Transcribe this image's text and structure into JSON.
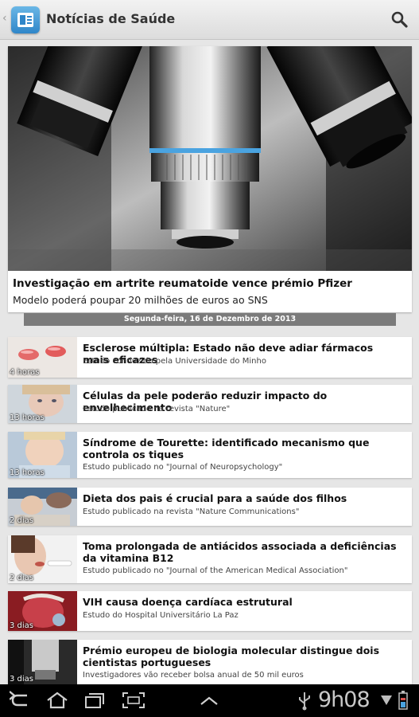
{
  "app": {
    "title": "Notícias de Saúde"
  },
  "icons": {
    "back": "back-caret-icon",
    "app": "news-app-icon",
    "search": "search-icon"
  },
  "featured": {
    "title": "Investigação em artrite reumatoide vence prémio Pfizer",
    "subtitle": "Modelo poderá poupar 20 milhões de euros ao SNS"
  },
  "date_header": "Segunda-feira, 16 de Dezembro de 2013",
  "news": [
    {
      "title": "Esclerose múltipla: Estado não deve adiar fármacos mais eficazes",
      "source": "Estudo conduzido pela Universidade do Minho",
      "age": "4 horas"
    },
    {
      "title": "Células da pele poderão reduzir impacto do envelhecimento",
      "source": "Estudo publicado na revista \"Nature\"",
      "age": "13 horas"
    },
    {
      "title": "Síndrome de Tourette: identificado mecanismo que controla os tiques",
      "source": "Estudo publicado no \"Journal of Neuropsychology\"",
      "age": "13 horas"
    },
    {
      "title": "Dieta dos pais é crucial para a saúde dos filhos",
      "source": "Estudo publicado na revista \"Nature Communications\"",
      "age": "2 dias"
    },
    {
      "title": "Toma prolongada de antiácidos associada a deficiências da vitamina B12",
      "source": "Estudo publicado no \"Journal of the American Medical Association\"",
      "age": "2 dias"
    },
    {
      "title": "VIH causa doença cardíaca estrutural",
      "source": "Estudo do Hospital Universitário La Paz",
      "age": "3 dias"
    },
    {
      "title": "Prémio europeu de biologia molecular distingue dois cientistas portugueses",
      "source": "Investigadores vão receber bolsa anual de 50 mil euros",
      "age": "3 dias"
    }
  ],
  "system_bar": {
    "time": "9h08",
    "buttons": [
      "back-icon",
      "home-icon",
      "recent-apps-icon",
      "screenshot-icon",
      "menu-up-icon"
    ],
    "status_icons": [
      "usb-icon",
      "wifi-icon",
      "battery-icon"
    ]
  }
}
